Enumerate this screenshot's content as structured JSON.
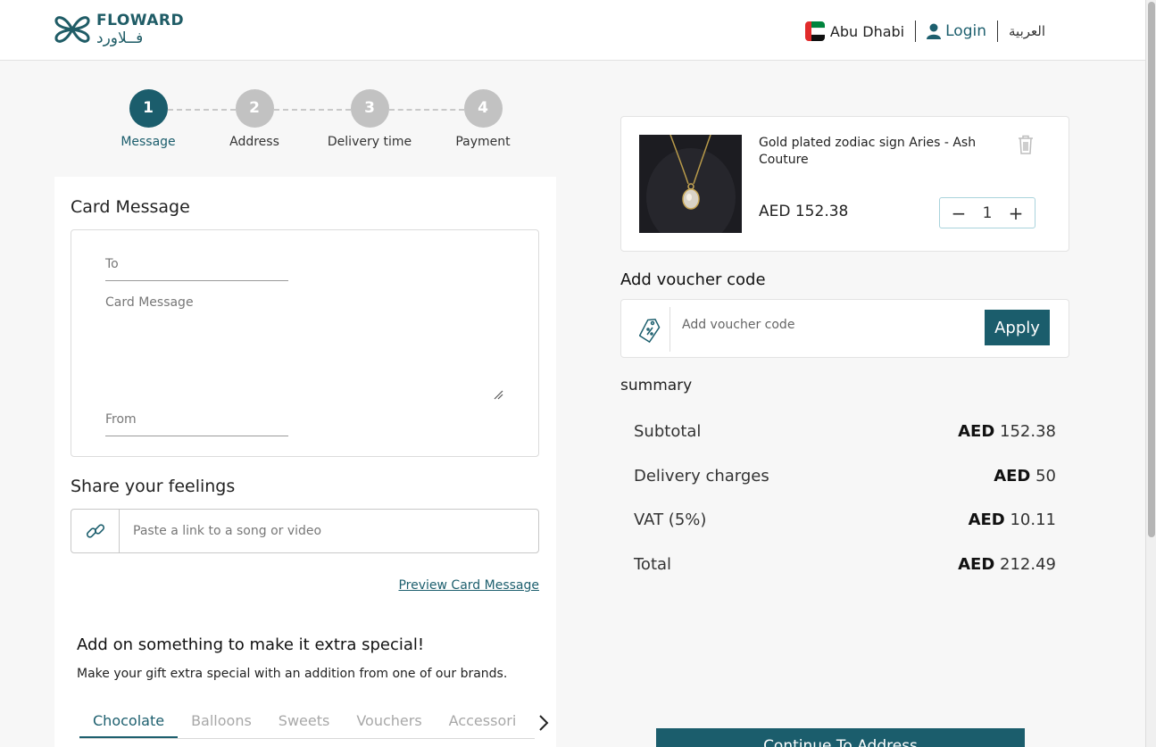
{
  "header": {
    "logo_en": "FLOWARD",
    "logo_ar": "فــلاورد",
    "city": "Abu Dhabi",
    "login": "Login",
    "language": "العربية"
  },
  "steps": [
    {
      "num": "1",
      "label": "Message",
      "active": true
    },
    {
      "num": "2",
      "label": "Address",
      "active": false
    },
    {
      "num": "3",
      "label": "Delivery time",
      "active": false
    },
    {
      "num": "4",
      "label": "Payment",
      "active": false
    }
  ],
  "card_message": {
    "title": "Card Message",
    "to_placeholder": "To",
    "message_placeholder": "Card Message",
    "from_placeholder": "From"
  },
  "share": {
    "title": "Share your feelings",
    "placeholder": "Paste a link to a song or video",
    "preview_link": "Preview Card Message"
  },
  "addons": {
    "title": "Add on something to make it extra special!",
    "subtitle": "Make your gift extra special with an addition from one of our brands.",
    "tabs": [
      "Chocolate",
      "Balloons",
      "Sweets",
      "Vouchers",
      "Accessories"
    ]
  },
  "cart": {
    "product_name": "Gold plated zodiac sign Aries - Ash Couture",
    "price": "AED 152.38",
    "quantity": "1"
  },
  "voucher": {
    "title": "Add voucher code",
    "placeholder": "Add voucher code",
    "apply": "Apply"
  },
  "summary": {
    "title": "summary",
    "currency": "AED",
    "rows": [
      {
        "label": "Subtotal",
        "value": "152.38"
      },
      {
        "label": "Delivery charges",
        "value": "50"
      },
      {
        "label": "VAT (5%)",
        "value": "10.11"
      },
      {
        "label": "Total",
        "value": "212.49"
      }
    ]
  },
  "proceed_button": "Continue To Address",
  "colors": {
    "brand": "#1b5d6c",
    "inactive_step": "#c2c2c2"
  }
}
